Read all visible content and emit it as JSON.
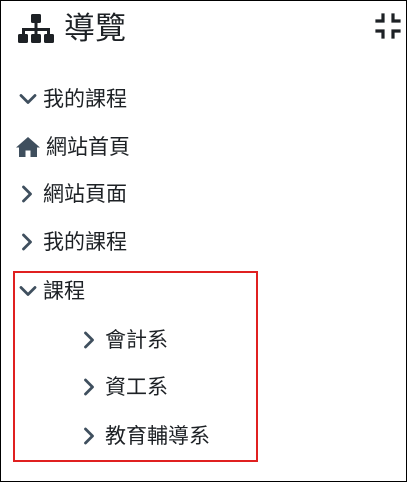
{
  "block": {
    "title": "導覽",
    "title_icon": "sitemap-icon",
    "collapse_icon": "compress-icon"
  },
  "nav": {
    "items": [
      {
        "label": "我的課程",
        "icon": "chevron-down-icon",
        "expanded": true
      },
      {
        "label": "網站首頁",
        "icon": "home-icon"
      },
      {
        "label": "網站頁面",
        "icon": "chevron-right-icon",
        "expanded": false
      },
      {
        "label": "我的課程",
        "icon": "chevron-right-icon",
        "expanded": false
      },
      {
        "label": "課程",
        "icon": "chevron-down-icon",
        "expanded": true,
        "children": [
          {
            "label": "會計系",
            "icon": "chevron-right-icon"
          },
          {
            "label": "資工系",
            "icon": "chevron-right-icon"
          },
          {
            "label": "教育輔導系",
            "icon": "chevron-right-icon"
          }
        ]
      }
    ]
  },
  "colors": {
    "text": "#1d2125",
    "icon": "#3f4f5e",
    "highlight_border": "#e02020",
    "panel_border": "#000000"
  }
}
